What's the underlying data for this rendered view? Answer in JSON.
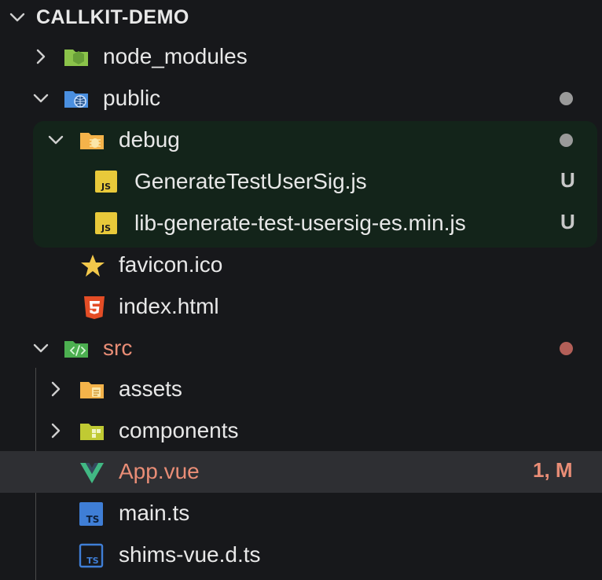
{
  "explorer": {
    "title": "CALLKIT-DEMO",
    "items": [
      {
        "label": "node_modules",
        "icon": "node-folder-icon"
      },
      {
        "label": "public",
        "icon": "public-folder-icon"
      },
      {
        "label": "debug",
        "icon": "debug-folder-icon"
      },
      {
        "label": "GenerateTestUserSig.js",
        "icon": "js-file-icon",
        "badge": "U"
      },
      {
        "label": "lib-generate-test-usersig-es.min.js",
        "icon": "js-file-icon",
        "badge": "U"
      },
      {
        "label": "favicon.ico",
        "icon": "star-icon"
      },
      {
        "label": "index.html",
        "icon": "html5-icon"
      },
      {
        "label": "src",
        "icon": "src-folder-icon"
      },
      {
        "label": "assets",
        "icon": "assets-folder-icon"
      },
      {
        "label": "components",
        "icon": "components-folder-icon"
      },
      {
        "label": "App.vue",
        "icon": "vue-icon",
        "badge": "1, M"
      },
      {
        "label": "main.ts",
        "icon": "ts-file-icon"
      },
      {
        "label": "shims-vue.d.ts",
        "icon": "ts-file-icon"
      }
    ]
  },
  "colors": {
    "background": "#17181b",
    "debug_highlight": "#13241a",
    "selected_row": "#2e2f33",
    "modified_text": "#e98d76",
    "untracked_badge": "#c8c8c8",
    "js_icon": "#e8c93a",
    "ts_icon": "#3f7ed6",
    "vue_icon": "#41b883",
    "html_icon": "#e44d26",
    "star_icon": "#f2c84b"
  }
}
